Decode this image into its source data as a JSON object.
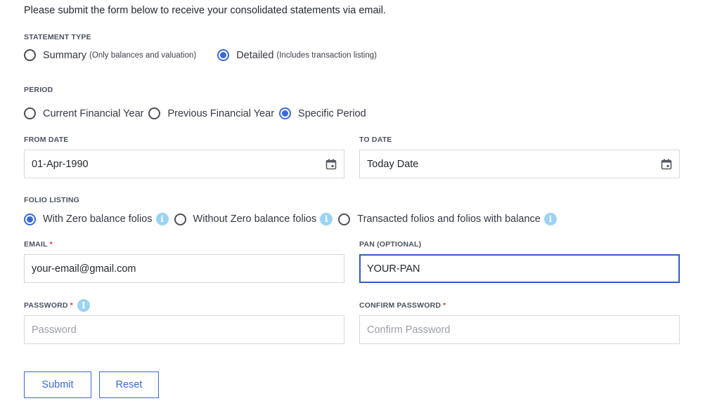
{
  "intro": "Please submit the form below to receive your consolidated statements via email.",
  "statement_type": {
    "label": "STATEMENT TYPE",
    "options": [
      {
        "label": "Summary",
        "hint": "(Only balances and valuation)",
        "checked": false
      },
      {
        "label": "Detailed",
        "hint": "(Includes transaction listing)",
        "checked": true
      }
    ]
  },
  "period": {
    "label": "PERIOD",
    "options": [
      {
        "label": "Current Financial Year",
        "checked": false
      },
      {
        "label": "Previous Financial Year",
        "checked": false
      },
      {
        "label": "Specific Period",
        "checked": true
      }
    ]
  },
  "from_date": {
    "label": "FROM DATE",
    "value": "01-Apr-1990"
  },
  "to_date": {
    "label": "TO DATE",
    "value": "Today Date"
  },
  "folio_listing": {
    "label": "FOLIO LISTING",
    "options": [
      {
        "label": "With Zero balance folios",
        "checked": true
      },
      {
        "label": "Without Zero balance folios",
        "checked": false
      },
      {
        "label": "Transacted folios and folios with balance",
        "checked": false
      }
    ]
  },
  "email": {
    "label": "EMAIL",
    "required_mark": "*",
    "value": "your-email@gmail.com"
  },
  "pan": {
    "label": "PAN (OPTIONAL)",
    "value": "YOUR-PAN"
  },
  "password": {
    "label": "PASSWORD",
    "required_mark": "*",
    "placeholder": "Password"
  },
  "confirm_password": {
    "label": "CONFIRM PASSWORD",
    "required_mark": "*",
    "placeholder": "Confirm Password"
  },
  "buttons": {
    "submit": "Submit",
    "reset": "Reset"
  },
  "icons": {
    "info": "info-icon",
    "calendar": "calendar-icon"
  },
  "colors": {
    "accent": "#3a6ad1",
    "info": "#9bd3f2",
    "required": "#e0353b"
  }
}
